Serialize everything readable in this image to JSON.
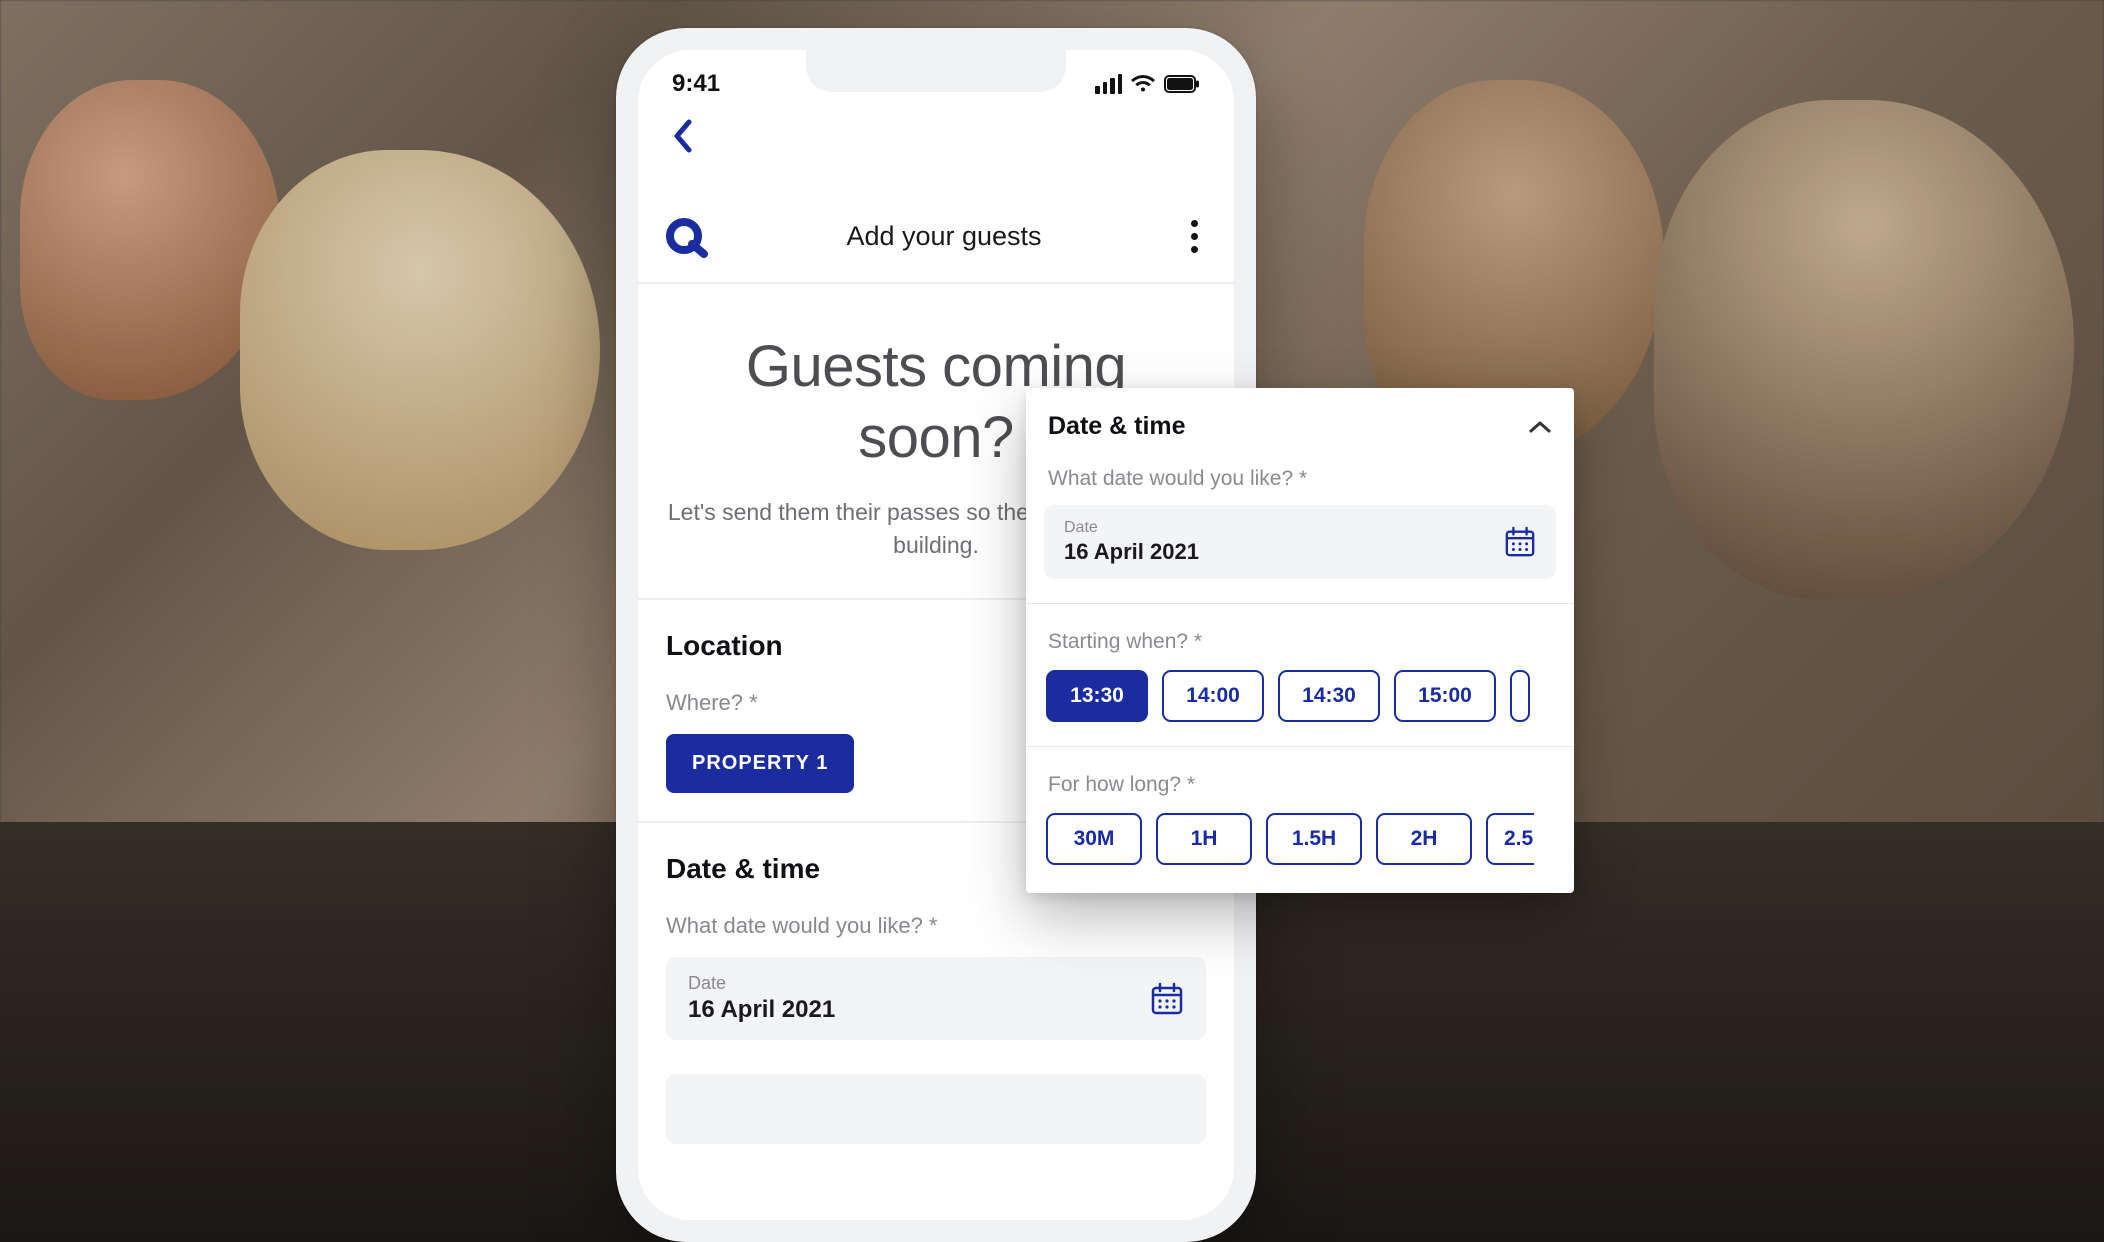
{
  "statusbar": {
    "time": "9:41"
  },
  "header": {
    "title": "Add your guests"
  },
  "hero": {
    "heading_line1": "Guests coming",
    "heading_line2": "soon?",
    "subtext": "Let's send them their passes so they can get into the building."
  },
  "location": {
    "section_title": "Location",
    "where_label": "Where? *",
    "property_chip": "PROPERTY 1"
  },
  "datetime": {
    "section_title": "Date & time",
    "date_question": "What date would you like? *",
    "date_field_label": "Date",
    "date_value": "16 April 2021",
    "start_question": "Starting when? *",
    "times": [
      "13:30",
      "14:00",
      "14:30",
      "15:00"
    ],
    "time_selected_index": 0,
    "duration_question": "For how long? *",
    "durations": [
      "30M",
      "1H",
      "1.5H",
      "2H",
      "2.5"
    ]
  },
  "colors": {
    "primary": "#1a2ca0"
  }
}
